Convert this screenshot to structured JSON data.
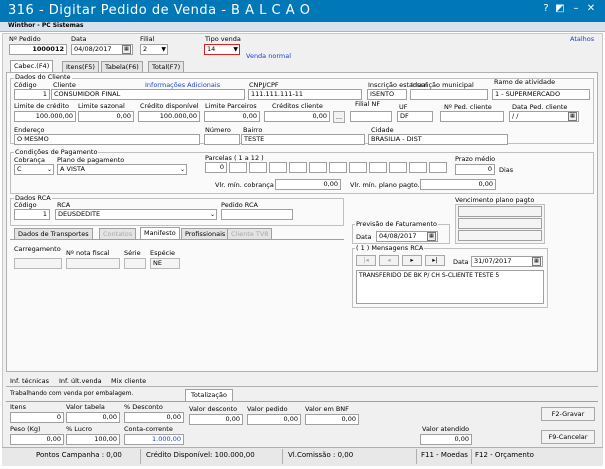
{
  "window": {
    "title": "316 - Digitar Pedido de Venda - B A L C A O",
    "subtitle": "Winthor - PC Sistemas",
    "help_btn": "?",
    "restore_btn": "◩",
    "minimize_btn": "–",
    "maximize_btn": "□",
    "close_btn": "✕"
  },
  "header": {
    "pedido_label": "Nº Pedido",
    "pedido_value": "1000012",
    "data_label": "Data",
    "data_value": "04/08/2017",
    "filial_label": "Filial",
    "filial_value": "2",
    "tipo_venda_label": "Tipo venda",
    "tipo_venda_value": "14",
    "venda_normal_label": "Venda normal",
    "atalhos_label": "Atalhos"
  },
  "tabs": [
    {
      "label": "Cabec.(F4)"
    },
    {
      "label": "Itens(F5)"
    },
    {
      "label": "Tabela(F6)"
    },
    {
      "label": "Total(F7)"
    }
  ],
  "cliente": {
    "group_label": "Dados do Cliente",
    "codigo_label": "Código",
    "codigo_value": "1",
    "cliente_label": "Cliente",
    "cliente_value": "CONSUMIDOR FINAL",
    "info_adicionais_label": "Informações Adicionais",
    "cnpj_label": "CNPJ/CPF",
    "cnpj_value": "111.111.111-11",
    "inscricao_estadual_label": "Inscrição estadual",
    "inscricao_estadual_value": "ISENTO",
    "inscricao_municipal_label": "Inscrição municipal",
    "inscricao_municipal_value": "",
    "ramo_label": "Ramo de atividade",
    "ramo_value": "1 - SUPERMERCADO",
    "limite_credito_label": "Limite de crédito",
    "limite_credito_value": "100.000,00",
    "limite_sazonal_label": "Limite sazonal",
    "limite_sazonal_value": "0,00",
    "credito_disponivel_label": "Crédito disponível",
    "credito_disponivel_value": "100.000,00",
    "limite_parceiros_label": "Limite Parceiros",
    "limite_parceiros_value": "0,00",
    "creditos_cliente_label": "Créditos cliente",
    "creditos_cliente_value": "0,00",
    "dots_btn": "...",
    "filial_nf_label": "Filial NF",
    "filial_nf_value": "",
    "uf_label": "UF",
    "uf_value": "DF",
    "ped_cliente_label": "Nº Ped. cliente",
    "ped_cliente_value": "",
    "data_ped_cliente_label": "Data Ped. cliente",
    "data_ped_cliente_value": "/ /",
    "endereco_label": "Endereço",
    "endereco_value": "O MESMO",
    "numero_label": "Número",
    "numero_value": "",
    "bairro_label": "Bairro",
    "bairro_value": "TESTE",
    "cidade_label": "Cidade",
    "cidade_value": "BRASILIA - DIST"
  },
  "pagamento": {
    "group_label": "Condições de Pagamento",
    "cobranca_label": "Cobrança",
    "cobranca_value": "C",
    "plano_label": "Plano de pagamento",
    "plano_value": "A VISTA",
    "parcelas_label": "Parcelas ( 1 a 12 )",
    "parcela_1_value": "0",
    "prazo_medio_label": "Prazo médio",
    "prazo_medio_value": "0",
    "dias_label": "Dias",
    "vr_min_cobranca_label": "Vlr. mín. cobrança",
    "vr_min_cobranca_value": "0,00",
    "vr_min_plano_label": "Vlr. mín. plano pagto.",
    "vr_min_plano_value": "0,00"
  },
  "rca": {
    "group_label": "Dados RCA",
    "codigo_label": "Código",
    "codigo_value": "1",
    "rca_label": "RCA",
    "rca_value": "DEUSDEDITE",
    "pedido_rca_label": "Pedido RCA",
    "pedido_rca_value": "",
    "vencimento_label": "Vencimento plano pagto",
    "previsao_label": "Previsão de Faturamento",
    "previsao_data_label": "Data",
    "previsao_data_value": "04/08/2017",
    "mensagens_label": "( 1 ) Mensagens RCA",
    "msg_first": "|◂",
    "msg_prev": "◂",
    "msg_next": "▸",
    "msg_last": "▸|",
    "msg_data_label": "Data",
    "msg_data_value": "31/07/2017",
    "msg_text": "TRANSFERIDO DE BK P/ CH S-CLIENTE TESTE 5"
  },
  "subtabs": [
    {
      "label": "Dados de Transportes"
    },
    {
      "label": "Contatos"
    },
    {
      "label": "Manifesto"
    },
    {
      "label": "Profissionais"
    },
    {
      "label": "Cliente TV8"
    }
  ],
  "manifesto": {
    "carregamento_label": "Carregamento",
    "carregamento_value": "",
    "nota_fiscal_label": "Nº nota fiscal",
    "nota_fiscal_value": "",
    "serie_label": "Série",
    "serie_value": "",
    "especie_label": "Espécie",
    "especie_value": "NE"
  },
  "links": {
    "inf_tecnicas": "Inf. técnicas",
    "inf_ult_venda": "Inf. últ.venda",
    "mix_cliente": "Mix cliente"
  },
  "totals": {
    "embalagem_label": "Trabalhando com venda por embalagem.",
    "totalizacao_tab": "Totalização",
    "itens_label": "Itens",
    "itens_value": "0",
    "valor_tabela_label": "Valor tabela",
    "valor_tabela_value": "0,00",
    "desconto_pct_label": "% Desconto",
    "desconto_pct_value": "0,00",
    "valor_desconto_label": "Valor desconto",
    "valor_desconto_value": "0,00",
    "valor_pedido_label": "Valor pedido",
    "valor_pedido_value": "0,00",
    "valor_bnf_label": "Valor em BNF",
    "valor_bnf_value": "0,00",
    "peso_label": "Peso (Kg)",
    "peso_value": "0,00",
    "lucro_label": "% Lucro",
    "lucro_value": "100,00",
    "conta_corrente_label": "Conta-corrente",
    "conta_corrente_value": "1.000,00",
    "valor_atendido_label": "Valor atendido",
    "valor_atendido_value": "0,00",
    "gravar_btn": "F2-Gravar",
    "cancelar_btn": "F9-Cancelar"
  },
  "status": {
    "pontos": "Pontos Campanha : 0,00",
    "credito": "Crédito Disponível: 100.000,00",
    "comissao": "Vl.Comissão : 0,00",
    "moedas": "F11 - Moedas",
    "orcamento": "F12 - Orçamento"
  },
  "colors": {
    "titlebar": "#0078b8",
    "highlight_red": "#e0201a",
    "link_blue": "#1a3fd0"
  }
}
